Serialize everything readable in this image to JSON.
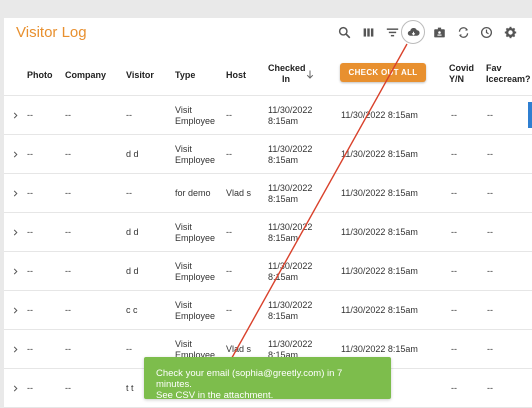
{
  "app": {
    "title": "Visitor Log"
  },
  "toolbar": {
    "icons": [
      "search-icon",
      "columns-icon",
      "filter-icon",
      "cloud-download-icon",
      "badge-icon",
      "refresh-icon",
      "clock-icon",
      "gear-icon"
    ],
    "active_icon": "cloud-download-icon"
  },
  "table": {
    "headers": {
      "photo": "Photo",
      "company": "Company",
      "visitor": "Visitor",
      "type": "Type",
      "host": "Host",
      "checked_in": "Checked In",
      "checkout_all": "CHECK OUT ALL",
      "covid": "Covid Y/N",
      "fav": "Fav Icecream?"
    },
    "sort_indicator": "arrow-down-icon",
    "rows": [
      {
        "photo": "--",
        "company": "--",
        "visitor": "--",
        "type": "Visit Employee",
        "host": "--",
        "checked_in": "11/30/2022 8:15am",
        "checked_out": "11/30/2022 8:15am",
        "covid": "--",
        "fav": "--"
      },
      {
        "photo": "--",
        "company": "--",
        "visitor": "d d",
        "type": "Visit Employee",
        "host": "--",
        "checked_in": "11/30/2022 8:15am",
        "checked_out": "11/30/2022 8:15am",
        "covid": "--",
        "fav": "--"
      },
      {
        "photo": "--",
        "company": "--",
        "visitor": "--",
        "type": "for demo",
        "host": "Vlad s",
        "checked_in": "11/30/2022 8:15am",
        "checked_out": "11/30/2022 8:15am",
        "covid": "--",
        "fav": "--"
      },
      {
        "photo": "--",
        "company": "--",
        "visitor": "d d",
        "type": "Visit Employee",
        "host": "--",
        "checked_in": "11/30/2022 8:15am",
        "checked_out": "11/30/2022 8:15am",
        "covid": "--",
        "fav": "--"
      },
      {
        "photo": "--",
        "company": "--",
        "visitor": "d d",
        "type": "Visit Employee",
        "host": "--",
        "checked_in": "11/30/2022 8:15am",
        "checked_out": "11/30/2022 8:15am",
        "covid": "--",
        "fav": "--"
      },
      {
        "photo": "--",
        "company": "--",
        "visitor": "c c",
        "type": "Visit Employee",
        "host": "--",
        "checked_in": "11/30/2022 8:15am",
        "checked_out": "11/30/2022 8:15am",
        "covid": "--",
        "fav": "--"
      },
      {
        "photo": "--",
        "company": "--",
        "visitor": "--",
        "type": "Visit Employee",
        "host": "Vlad s",
        "checked_in": "11/30/2022 8:15am",
        "checked_out": "11/30/2022 8:15am",
        "covid": "--",
        "fav": "--"
      },
      {
        "photo": "--",
        "company": "--",
        "visitor": "t t",
        "type": "",
        "host": "",
        "checked_in": "",
        "checked_out": "",
        "covid": "--",
        "fav": "--"
      }
    ]
  },
  "toast": {
    "line1": "Check your email (sophia@greetly.com) in 7 minutes.",
    "line2": "See CSV in the attachment."
  },
  "colors": {
    "accent": "#e8902f",
    "toast": "#7dbd4c",
    "annotation_arrow": "#d9412b",
    "scroll_marker": "#2f7fd1"
  }
}
